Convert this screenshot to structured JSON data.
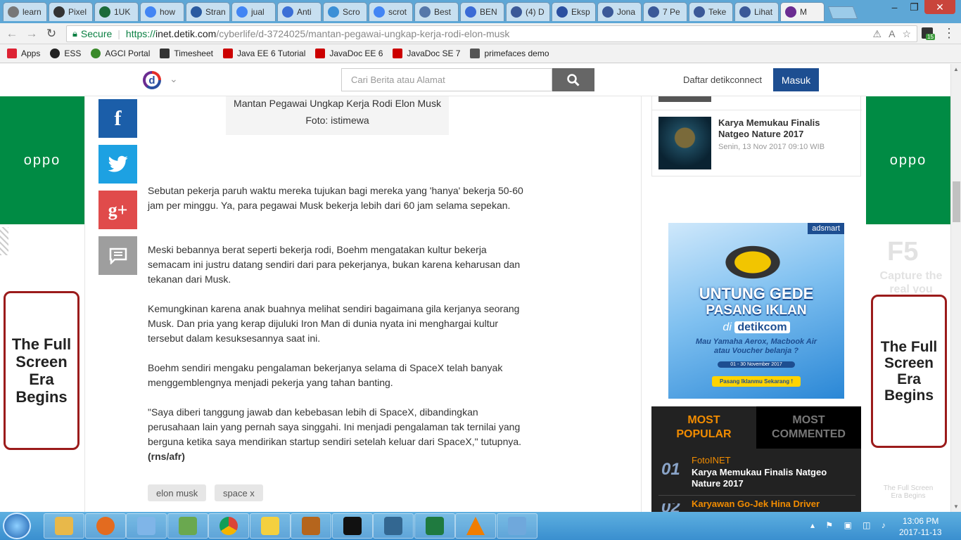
{
  "tabs": [
    {
      "title": "learn",
      "icon": "document-icon",
      "color": "#777777"
    },
    {
      "title": "Pixel",
      "icon": "wikipedia-icon",
      "color": "#333333"
    },
    {
      "title": "1UK",
      "icon": "instructables-icon",
      "color": "#1c6b3a"
    },
    {
      "title": "how",
      "icon": "google-icon",
      "color": "#4285f4"
    },
    {
      "title": "Stran",
      "icon": "strangeloop-icon",
      "color": "#2a5aa0"
    },
    {
      "title": "jual",
      "icon": "google-icon",
      "color": "#4285f4"
    },
    {
      "title": "Anti",
      "icon": "antigravity-icon",
      "color": "#3b6fd6"
    },
    {
      "title": "Scro",
      "icon": "refresh-icon",
      "color": "#3b8fd6"
    },
    {
      "title": "scrot",
      "icon": "google-icon",
      "color": "#4285f4"
    },
    {
      "title": "Best",
      "icon": "forum-icon",
      "color": "#5577aa"
    },
    {
      "title": "BEN",
      "icon": "bitcoin-icon",
      "color": "#3a6bd6"
    },
    {
      "title": "(4) D",
      "icon": "facebook-icon",
      "color": "#3b5998"
    },
    {
      "title": "Eksp",
      "icon": "detik-icon",
      "color": "#2a4fa0"
    },
    {
      "title": "Jona",
      "icon": "facebook-icon",
      "color": "#3b5998"
    },
    {
      "title": "7 Pe",
      "icon": "facebook-icon",
      "color": "#3b5998"
    },
    {
      "title": "Teke",
      "icon": "facebook-icon",
      "color": "#3b5998"
    },
    {
      "title": "Lihat",
      "icon": "facebook-icon",
      "color": "#3b5998"
    },
    {
      "title": "M",
      "icon": "detik-info-icon",
      "color": "#6b2c91"
    }
  ],
  "browser": {
    "secure_label": "Secure",
    "url_scheme": "https://",
    "url_host": "inet.detik.com",
    "url_path": "/cyberlife/d-3724025/mantan-pegawai-ungkap-kerja-rodi-elon-musk",
    "extension_badge": "15"
  },
  "bookmarks": [
    {
      "label": "Apps",
      "icon": "apps-grid-icon"
    },
    {
      "label": "ESS",
      "icon": "ess-icon"
    },
    {
      "label": "AGCI Portal",
      "icon": "agci-icon"
    },
    {
      "label": "Timesheet",
      "icon": "timesheet-icon"
    },
    {
      "label": "Java EE 6 Tutorial",
      "icon": "oracle-icon"
    },
    {
      "label": "JavaDoc EE 6",
      "icon": "oracle-icon"
    },
    {
      "label": "JavaDoc SE 7",
      "icon": "oracle-icon"
    },
    {
      "label": "primefaces demo",
      "icon": "primefaces-icon"
    }
  ],
  "header": {
    "logo_letter": "d",
    "search_placeholder": "Cari Berita atau Alamat",
    "register_label": "Daftar detikconnect",
    "login_label": "Masuk"
  },
  "article": {
    "caption": "Mantan Pegawai Ungkap Kerja Rodi Elon Musk",
    "photo_credit": "Foto: istimewa",
    "paragraphs": [
      "Sebutan pekerja paruh waktu mereka tujukan bagi mereka yang 'hanya' bekerja 50-60 jam per minggu. Ya, para pegawai Musk bekerja lebih dari 60 jam selama sepekan.",
      "Meski bebannya berat seperti bekerja rodi, Boehm mengatakan kultur bekerja semacam ini justru datang sendiri dari para pekerjanya, bukan karena keharusan dan tekanan dari Musk.",
      "Kemungkinan karena anak buahnya melihat sendiri bagaimana gila kerjanya seorang Musk. Dan pria yang kerap dijuluki Iron Man di dunia nyata ini menghargai kultur tersebut dalam kesuksesannya saat ini.",
      "Boehm sendiri mengaku pengalaman bekerjanya selama di SpaceX telah banyak menggemblengnya menjadi pekerja yang tahan banting.",
      "\"Saya diberi tanggung jawab dan kebebasan lebih di SpaceX, dibandingkan perusahaan lain yang pernah saya singgahi. Ini menjadi pengalaman tak ternilai yang berguna ketika saya mendirikan startup sendiri setelah keluar dari SpaceX,\" tutupnya."
    ],
    "signature": "(rns/afr)",
    "tags": [
      "elon musk",
      "space x"
    ]
  },
  "share": [
    {
      "name": "facebook",
      "glyph": "f",
      "color": "#1b5ea9"
    },
    {
      "name": "twitter",
      "glyph": "t",
      "color": "#1da1e2"
    },
    {
      "name": "google-plus",
      "glyph": "g+",
      "color": "#e04b4b"
    },
    {
      "name": "comment",
      "glyph": "c",
      "color": "#9e9e9e"
    }
  ],
  "sidebar": {
    "related": {
      "title": "Karya Memukau Finalis Natgeo Nature 2017",
      "date": "Senin, 13 Nov 2017 09:10 WIB"
    },
    "ad": {
      "brand": "adsmart",
      "headline1": "UNTUNG GEDE",
      "headline2": "PASANG IKLAN",
      "di": "di",
      "site": "detikcom",
      "subtitle": "Mau Yamaha Aerox, Macbook Air atau Voucher belanja ?",
      "dates": "01 - 30 November 2017",
      "cta": "Pasang Iklanmu Sekarang !"
    },
    "tabs": {
      "popular": "MOST POPULAR",
      "commented": "MOST COMMENTED"
    },
    "popular": [
      {
        "rank": "01",
        "channel": "FotoINET",
        "title": "Karya Memukau Finalis Natgeo Nature 2017"
      },
      {
        "rank": "02",
        "channel": "",
        "title": "Karyawan Go-Jek Hina Driver"
      }
    ]
  },
  "side_ads": {
    "brand": "oppo",
    "tagline": "The Full Screen Era Begins",
    "model": "F5",
    "capture": "Capture the real you"
  },
  "taskbar": {
    "time": "13:06 PM",
    "date": "2017-11-13",
    "apps": [
      "file-explorer-icon",
      "firefox-icon",
      "notepad-icon",
      "chart-app-icon",
      "chrome-icon",
      "sticky-notes-icon",
      "java-ee-ide-icon",
      "inkscape-icon",
      "pgadmin-icon",
      "excel-icon",
      "vlc-icon",
      "paint-icon"
    ]
  }
}
